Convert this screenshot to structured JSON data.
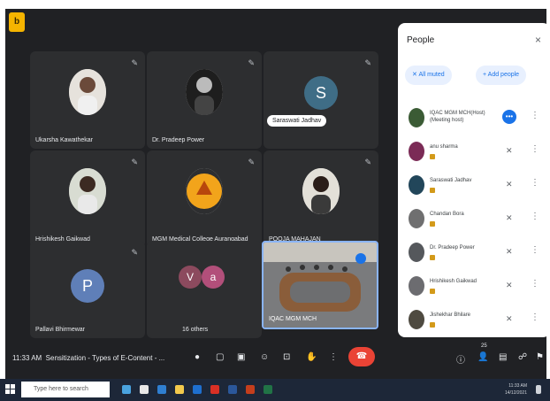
{
  "meeting": {
    "title": "Sensitization - Types of E-Content - ...",
    "time": "11:33 AM",
    "badge_letter": "b"
  },
  "tiles": [
    {
      "name": "Ukarsha Kawathekar"
    },
    {
      "name": "Dr. Pradeep Power"
    },
    {
      "name": ""
    },
    {
      "name": "Hrishikesh Gaikwad"
    },
    {
      "name": "MGM Medical College Aurangabad"
    },
    {
      "name": "POOJA MAHAJAN"
    },
    {
      "name": "Pallavi Bhirmewar"
    },
    {
      "name": "16 others"
    },
    {
      "name": "IQAC MGM MCH"
    }
  ],
  "tooltip": "Saraswati Jadhav",
  "group_letters": [
    "V",
    "a"
  ],
  "single_letter": "P",
  "hover_letter": "S",
  "people_panel": {
    "title": "People",
    "close_icon": "×",
    "mute_all": "All muted",
    "add_people": "Add people",
    "participants": [
      {
        "name": "IQAC MGM MCH(Host) (Meeting host)",
        "color": "#3b5b35"
      },
      {
        "name": "anu sharma",
        "color": "#7b2b56"
      },
      {
        "name": "Saraswati Jadhav",
        "color": "#22465a"
      },
      {
        "name": "Chandan Bora",
        "color": "#6f6f70"
      },
      {
        "name": "Dr. Pradeep Power",
        "color": "#55585c"
      },
      {
        "name": "Hrishikesh Gaikwad",
        "color": "#6c6c70"
      },
      {
        "name": "Jishekhar Bhilare",
        "color": "#4e4a40"
      }
    ]
  },
  "controls": {
    "people_count": "25"
  },
  "taskbar": {
    "search_placeholder": "Type here to search",
    "tray_time": "11:33 AM",
    "tray_date": "14/12/2021"
  },
  "colors": {
    "meet_bg": "#202124",
    "tile_bg": "#2d2e30",
    "end_call": "#ea4335",
    "accent": "#1a73e8",
    "taskbar": "#1d2738"
  }
}
